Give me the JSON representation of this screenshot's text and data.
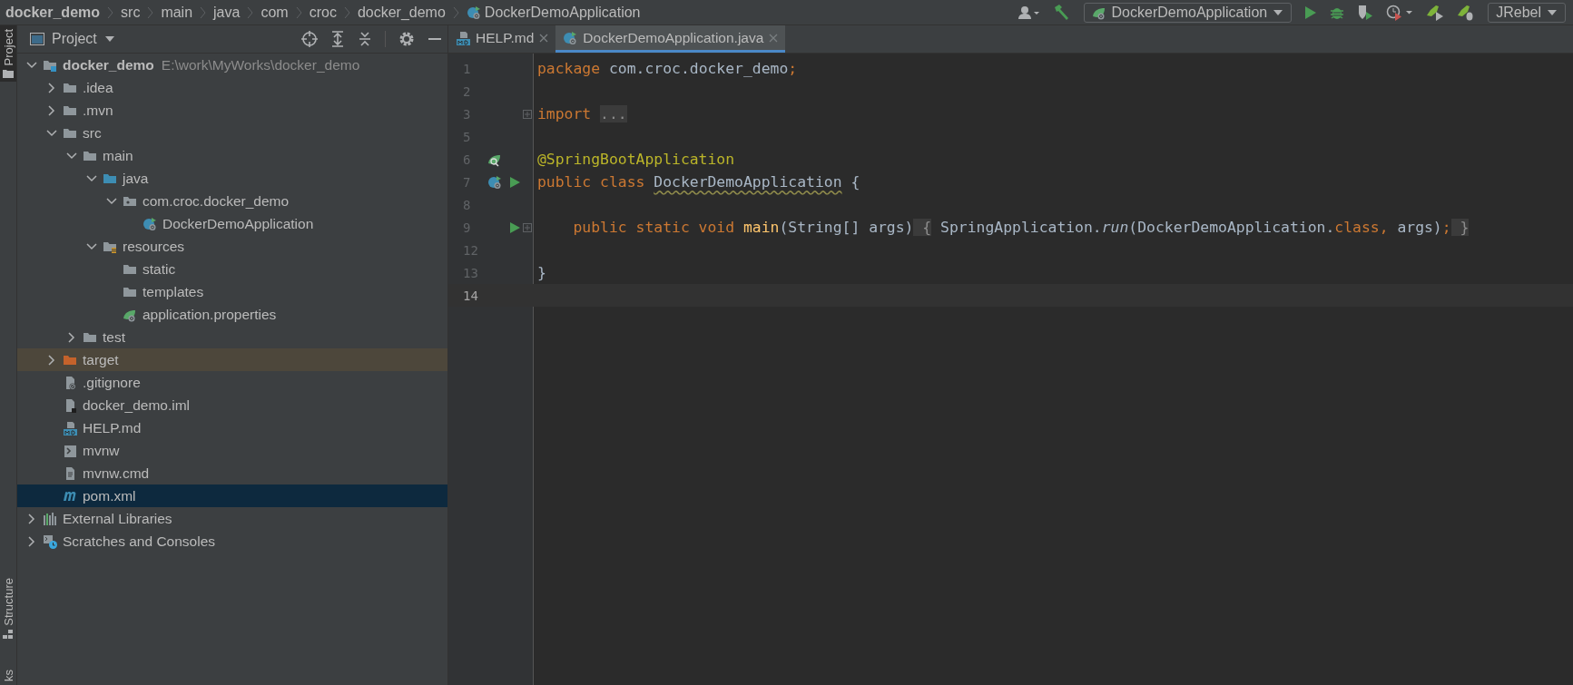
{
  "breadcrumbs": [
    {
      "label": "docker_demo",
      "kind": "project"
    },
    {
      "label": "src",
      "kind": "dir"
    },
    {
      "label": "main",
      "kind": "dir"
    },
    {
      "label": "java",
      "kind": "dir"
    },
    {
      "label": "com",
      "kind": "dir"
    },
    {
      "label": "croc",
      "kind": "dir"
    },
    {
      "label": "docker_demo",
      "kind": "dir"
    },
    {
      "label": "DockerDemoApplication",
      "kind": "spring-class"
    }
  ],
  "toolbar": {
    "run_config": "DockerDemoApplication",
    "jrebel": "JRebel"
  },
  "tool_stripe": {
    "top": "Project",
    "bottom": [
      "Structure",
      "ks"
    ]
  },
  "project_panel": {
    "title": "Project",
    "tree": [
      {
        "label": "docker_demo",
        "path": "E:\\work\\MyWorks\\docker_demo",
        "kind": "module",
        "expanded": true,
        "selected": false,
        "highlighted": false,
        "children": [
          {
            "label": ".idea",
            "kind": "folder",
            "expanded": false,
            "selected": false,
            "highlighted": false
          },
          {
            "label": ".mvn",
            "kind": "folder",
            "expanded": false,
            "selected": false,
            "highlighted": false
          },
          {
            "label": "src",
            "kind": "folder",
            "expanded": true,
            "selected": false,
            "highlighted": false,
            "children": [
              {
                "label": "main",
                "kind": "folder",
                "expanded": true,
                "selected": false,
                "highlighted": false,
                "children": [
                  {
                    "label": "java",
                    "kind": "source-folder",
                    "expanded": true,
                    "selected": false,
                    "highlighted": false,
                    "children": [
                      {
                        "label": "com.croc.docker_demo",
                        "kind": "package",
                        "expanded": true,
                        "selected": false,
                        "highlighted": false,
                        "children": [
                          {
                            "label": "DockerDemoApplication",
                            "kind": "spring-class",
                            "selected": false,
                            "highlighted": false
                          }
                        ]
                      }
                    ]
                  },
                  {
                    "label": "resources",
                    "kind": "resource-folder",
                    "expanded": true,
                    "selected": false,
                    "highlighted": false,
                    "children": [
                      {
                        "label": "static",
                        "kind": "folder",
                        "selected": false,
                        "highlighted": false
                      },
                      {
                        "label": "templates",
                        "kind": "folder",
                        "selected": false,
                        "highlighted": false
                      },
                      {
                        "label": "application.properties",
                        "kind": "spring-config",
                        "selected": false,
                        "highlighted": false
                      }
                    ]
                  }
                ]
              },
              {
                "label": "test",
                "kind": "folder",
                "expanded": false,
                "selected": false,
                "highlighted": false
              }
            ]
          },
          {
            "label": "target",
            "kind": "excluded-folder",
            "expanded": false,
            "selected": false,
            "highlighted": true
          },
          {
            "label": ".gitignore",
            "kind": "ignore-file",
            "selected": false,
            "highlighted": false
          },
          {
            "label": "docker_demo.iml",
            "kind": "iml-file",
            "selected": false,
            "highlighted": false
          },
          {
            "label": "HELP.md",
            "kind": "md-file",
            "selected": false,
            "highlighted": false
          },
          {
            "label": "mvnw",
            "kind": "script-file",
            "selected": false,
            "highlighted": false
          },
          {
            "label": "mvnw.cmd",
            "kind": "text-file",
            "selected": false,
            "highlighted": false
          },
          {
            "label": "pom.xml",
            "kind": "maven-file",
            "selected": true,
            "highlighted": false
          }
        ]
      },
      {
        "label": "External Libraries",
        "kind": "libraries",
        "expanded": false,
        "selected": false,
        "highlighted": false
      },
      {
        "label": "Scratches and Consoles",
        "kind": "scratches",
        "expanded": false,
        "selected": false,
        "highlighted": false
      }
    ]
  },
  "editor": {
    "tabs": [
      {
        "label": "HELP.md",
        "kind": "md-file",
        "selected": false
      },
      {
        "label": "DockerDemoApplication.java",
        "kind": "spring-class",
        "selected": true
      }
    ],
    "lines": [
      {
        "number": "1",
        "current": false,
        "fold": false,
        "tokens": [
          {
            "t": "package",
            "kind": "keyword"
          },
          {
            "t": " com.croc.docker_demo",
            "kind": "plain"
          },
          {
            "t": ";",
            "kind": "keyword"
          }
        ]
      },
      {
        "number": "2",
        "current": false,
        "fold": false
      },
      {
        "number": "3",
        "current": false,
        "fold": true,
        "tokens": [
          {
            "t": "import ",
            "kind": "keyword"
          },
          {
            "t": "...",
            "kind": "folded"
          }
        ]
      },
      {
        "number": "5",
        "current": false,
        "fold": false
      },
      {
        "number": "6",
        "current": false,
        "fold": false,
        "gutter": [
          {
            "kind": "spring-bean"
          }
        ],
        "tokens": [
          {
            "t": "@SpringBootApplication",
            "kind": "annotation"
          }
        ]
      },
      {
        "number": "7",
        "current": false,
        "fold": false,
        "gutter": [
          {
            "kind": "spring-class"
          },
          {
            "kind": "run"
          }
        ],
        "tokens": [
          {
            "t": "public class ",
            "kind": "keyword"
          },
          {
            "t": "DockerDemoApplication",
            "kind": "squiggle"
          },
          {
            "t": " {",
            "kind": "plain"
          }
        ]
      },
      {
        "number": "8",
        "current": false,
        "fold": false
      },
      {
        "number": "9",
        "current": false,
        "fold": true,
        "gutter": [
          {
            "kind": "run"
          }
        ],
        "tokens": [
          {
            "t": "    public static void ",
            "kind": "keyword"
          },
          {
            "t": "main",
            "kind": "method"
          },
          {
            "t": "(String[] args)",
            "kind": "plain"
          },
          {
            "t": " {",
            "kind": "folded"
          },
          {
            "t": " SpringApplication.",
            "kind": "plain"
          },
          {
            "t": "run",
            "kind": "static-call"
          },
          {
            "t": "(DockerDemoApplication.",
            "kind": "plain"
          },
          {
            "t": "class, ",
            "kind": "keyword"
          },
          {
            "t": "args)",
            "kind": "plain"
          },
          {
            "t": ";",
            "kind": "keyword"
          },
          {
            "t": " }",
            "kind": "folded"
          }
        ]
      },
      {
        "number": "12",
        "current": false,
        "fold": false
      },
      {
        "number": "13",
        "current": false,
        "fold": false,
        "tokens": [
          {
            "t": "}",
            "kind": "plain"
          }
        ]
      },
      {
        "number": "14",
        "current": true,
        "fold": false
      }
    ]
  }
}
